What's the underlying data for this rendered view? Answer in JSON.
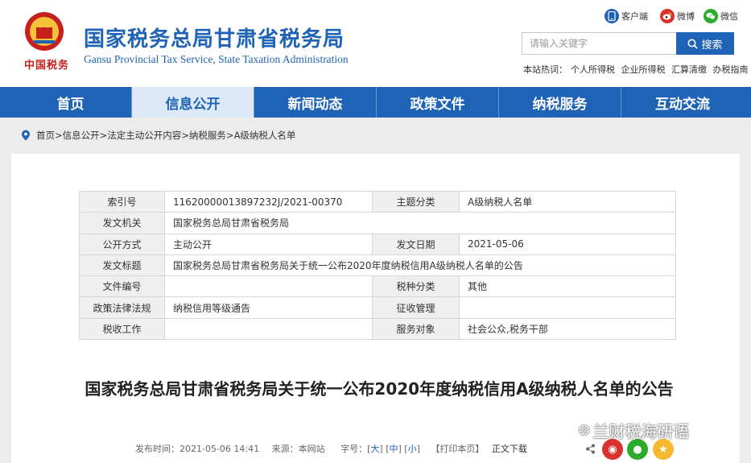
{
  "header": {
    "brand_logo": "中国税务",
    "title_cn": "国家税务总局甘肃省税务局",
    "title_en": "Gansu Provincial Tax Service, State Taxation Administration",
    "social": [
      {
        "label": "客户端",
        "icon": "mobile-client-icon",
        "color": "#1f63b6"
      },
      {
        "label": "微博",
        "icon": "weibo-icon",
        "color": "#d9322e"
      },
      {
        "label": "微信",
        "icon": "wechat-icon",
        "color": "#2bad2b"
      }
    ],
    "search_placeholder": "请输入关键字",
    "search_button": "搜索",
    "hot_label": "本站热词：",
    "hot_words": [
      "个人所得税",
      "企业所得税",
      "汇算清缴",
      "办税指南"
    ]
  },
  "nav": [
    {
      "label": "首页",
      "active": false
    },
    {
      "label": "信息公开",
      "active": true
    },
    {
      "label": "新闻动态",
      "active": false
    },
    {
      "label": "政策文件",
      "active": false
    },
    {
      "label": "纳税服务",
      "active": false
    },
    {
      "label": "互动交流",
      "active": false
    }
  ],
  "breadcrumb": [
    "首页",
    "信息公开",
    "法定主动公开内容",
    "纳税服务",
    "A级纳税人名单"
  ],
  "meta": {
    "rows": [
      {
        "k1": "索引号",
        "v1": "11620000013897232J/2021-00370",
        "k2": "主题分类",
        "v2": "A级纳税人名单"
      },
      {
        "k1": "发文机关",
        "v1": "国家税务总局甘肃省税务局"
      },
      {
        "k1": "公开方式",
        "v1": "主动公开",
        "k2": "发文日期",
        "v2": "2021-05-06"
      },
      {
        "k1": "发文标题",
        "v1": "国家税务总局甘肃省税务局关于统一公布2020年度纳税信用A级纳税人名单的公告"
      },
      {
        "k1": "文件编号",
        "v1": "",
        "k2": "税种分类",
        "v2": "其他"
      },
      {
        "k1": "政策法律法规",
        "v1": "纳税信用等级通告",
        "k2": "征收管理",
        "v2": ""
      },
      {
        "k1": "税收工作",
        "v1": "",
        "k2": "服务对象",
        "v2": "社会公众,税务干部"
      }
    ]
  },
  "article": {
    "title": "国家税务总局甘肃省税务局关于统一公布2020年度纳税信用A级纳税人名单的公告",
    "publish": "发布时间：2021-05-06 14:41",
    "source": "来源：本网站",
    "font_label": "字号：",
    "size_large": "大",
    "size_medium": "中",
    "size_small": "小",
    "print": "【打印本页】",
    "download": "正文下载"
  },
  "watermark": "兰财税海研语",
  "colors": {
    "brand": "#1f63b6",
    "red": "#c8201e"
  }
}
